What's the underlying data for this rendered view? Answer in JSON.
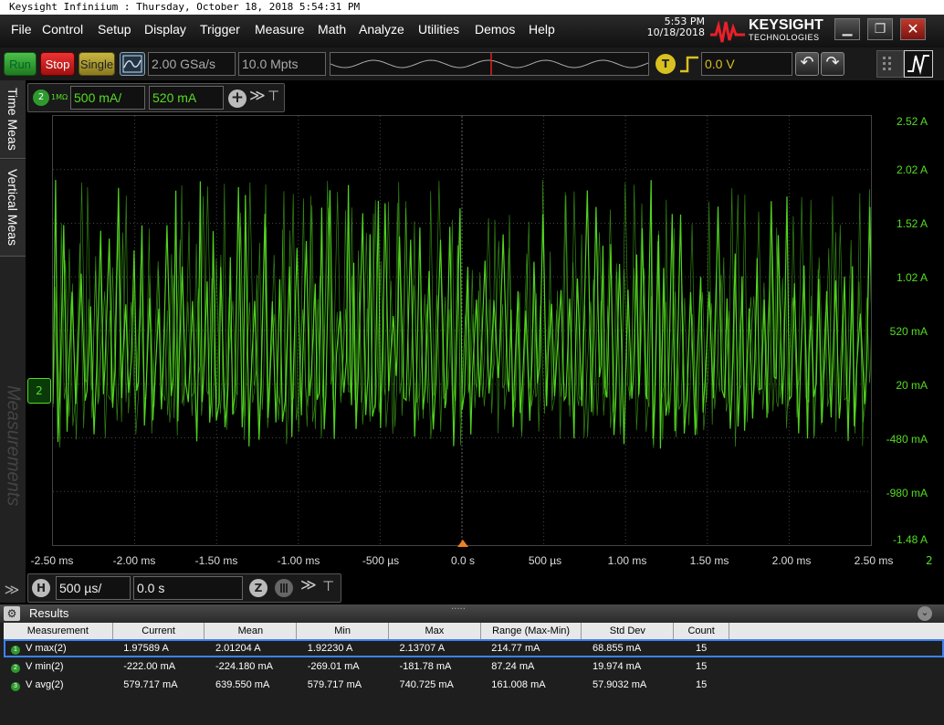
{
  "window_title": "Keysight Infiniium : Thursday, October 18, 2018 5:54:31 PM",
  "menu": [
    "File",
    "Control",
    "Setup",
    "Display",
    "Trigger",
    "Measure",
    "Math",
    "Analyze",
    "Utilities",
    "Demos",
    "Help"
  ],
  "clock": {
    "time": "5:53 PM",
    "date": "10/18/2018"
  },
  "logo": {
    "name": "KEYSIGHT",
    "sub": "TECHNOLOGIES"
  },
  "window_buttons": {
    "minimize": "▁",
    "maximize": "❐",
    "close": "✕"
  },
  "toolbar": {
    "run": "Run",
    "stop": "Stop",
    "single": "Single",
    "sample_rate": "2.00 GSa/s",
    "memory_depth": "10.0 Mpts",
    "trigger_badge": "T",
    "trigger_level": "0.0 V",
    "undo": "↶",
    "redo": "↷"
  },
  "side_tabs": {
    "time_meas": "Time Meas",
    "vertical_meas": "Vertical Meas",
    "measurements": "Measurements"
  },
  "channel": {
    "number": "2",
    "impedance": "1MΩ",
    "scale": "500 mA/",
    "offset": "520 mA",
    "add": "+",
    "more": "≫",
    "pin": "⊤"
  },
  "y_axis": [
    "2.52 A",
    "2.02 A",
    "1.52 A",
    "1.02 A",
    "520 mA",
    "20 mA",
    "-480 mA",
    "-980 mA",
    "-1.48 A"
  ],
  "x_axis": [
    "-2.50 ms",
    "-2.00 ms",
    "-1.50 ms",
    "-1.00 ms",
    "-500 µs",
    "0.0 s",
    "500 µs",
    "1.00 ms",
    "1.50 ms",
    "2.00 ms",
    "2.50 ms"
  ],
  "x_axis_channel_marker": "2",
  "ground_marker": "2",
  "horizontal": {
    "badge": "H",
    "scale": "500 µs/",
    "position": "0.0 s",
    "zoom": "Z",
    "more": "≫",
    "pin": "⊤"
  },
  "results": {
    "title": "Results",
    "collapse": "⌄",
    "handle": "·····",
    "columns": [
      "Measurement",
      "Current",
      "Mean",
      "Min",
      "Max",
      "Range (Max-Min)",
      "Std Dev",
      "Count"
    ],
    "rows": [
      {
        "index": "1",
        "cells": [
          "V max(2)",
          "1.97589 A",
          "2.01204 A",
          "1.92230 A",
          "2.13707 A",
          "214.77 mA",
          "68.855 mA",
          "15"
        ]
      },
      {
        "index": "2",
        "cells": [
          "V min(2)",
          "-222.00 mA",
          "-224.180 mA",
          "-269.01 mA",
          "-181.78 mA",
          "87.24 mA",
          "19.974 mA",
          "15"
        ]
      },
      {
        "index": "3",
        "cells": [
          "V avg(2)",
          "579.717 mA",
          "639.550 mA",
          "579.717 mA",
          "740.725 mA",
          "161.008 mA",
          "57.9032 mA",
          "15"
        ]
      }
    ]
  },
  "colors": {
    "trace": "#55dd22",
    "accent": "#3b82f6",
    "trigger": "#d8c020",
    "run": "#2e9a2e",
    "stop": "#d02020"
  }
}
